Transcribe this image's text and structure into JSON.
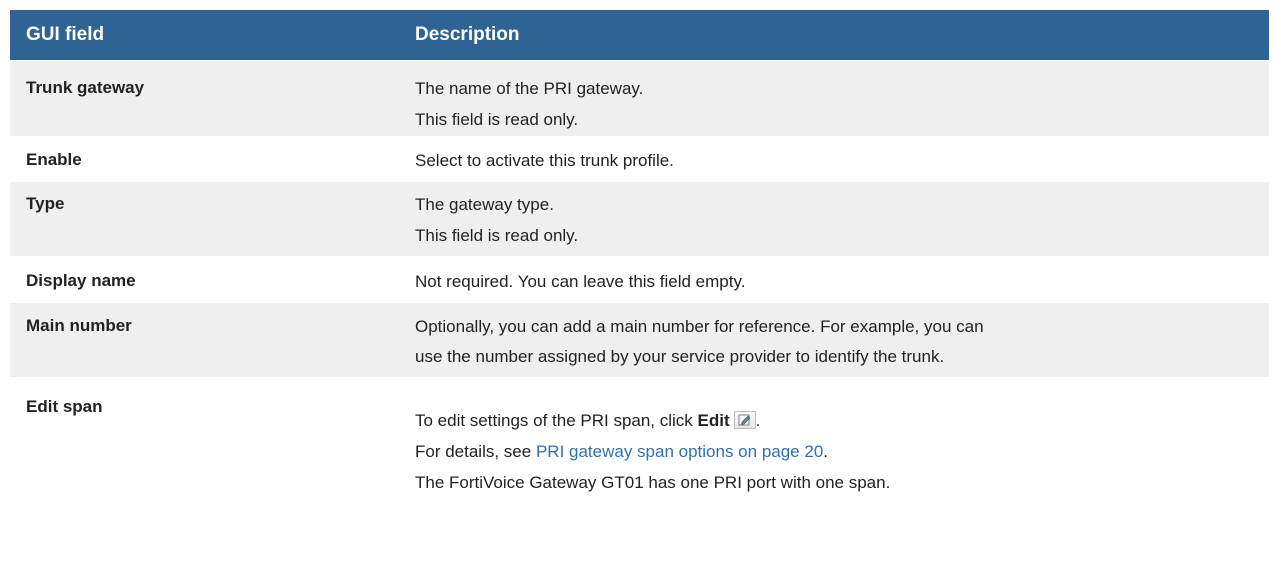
{
  "header": {
    "col1": "GUI field",
    "col2": "Description"
  },
  "rows": [
    {
      "field": "Trunk gateway",
      "lines": [
        "The name of the PRI gateway.",
        "This field is read only."
      ]
    },
    {
      "field": "Enable",
      "lines": [
        "Select to activate this trunk profile."
      ]
    },
    {
      "field": "Type",
      "lines": [
        "The gateway type.",
        "This field is read only."
      ]
    },
    {
      "field": "Display name",
      "lines": [
        "Not required. You can leave this field empty."
      ]
    },
    {
      "field": "Main number",
      "lines": [
        "Optionally, you can add a main number for reference. For example, you can",
        "use the number assigned by your service provider to identify the trunk."
      ]
    },
    {
      "field": "Edit span",
      "edit_prefix": "To edit settings of the PRI span, click ",
      "edit_bold": "Edit",
      "edit_suffix": ".",
      "details_prefix": "For details, see ",
      "details_link": "PRI gateway span options on page 20",
      "details_suffix": ".",
      "last_line": "The FortiVoice Gateway GT01 has one PRI port with one span."
    }
  ],
  "colors": {
    "header_bg": "#2e6394",
    "alt_row_bg": "#efefef",
    "link": "#2f6fb3"
  },
  "icons": [
    "edit-icon"
  ]
}
